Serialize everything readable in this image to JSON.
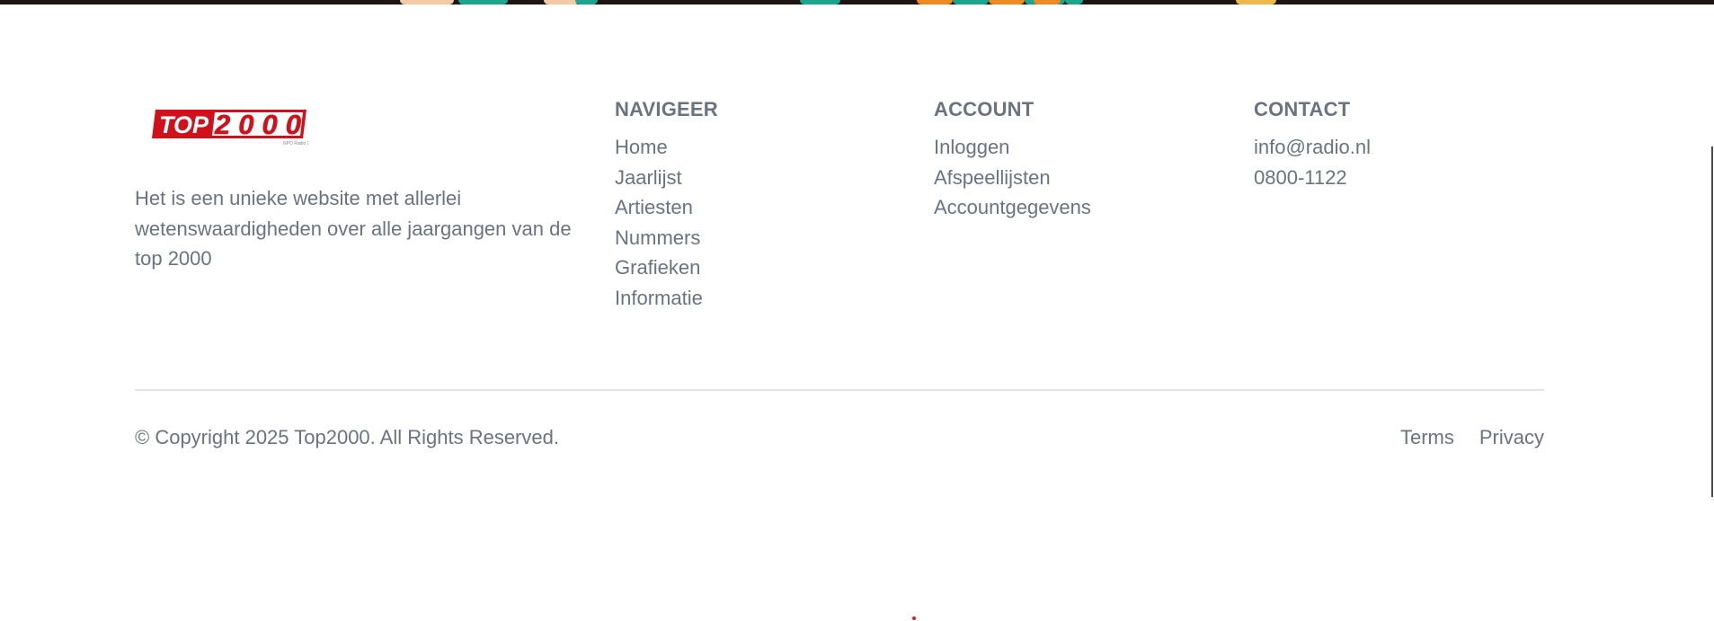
{
  "brand": {
    "logo_text": "TOP2000",
    "logo_small_text": "NPO Radio 2",
    "description": "Het is een unieke website met allerlei wetenswaardigheden over alle jaargangen van de top 2000"
  },
  "nav": {
    "heading": "NAVIGEER",
    "items": [
      {
        "label": "Home"
      },
      {
        "label": "Jaarlijst"
      },
      {
        "label": "Artiesten"
      },
      {
        "label": "Nummers"
      },
      {
        "label": "Grafieken"
      },
      {
        "label": "Informatie"
      }
    ]
  },
  "account": {
    "heading": "ACCOUNT",
    "items": [
      {
        "label": "Inloggen"
      },
      {
        "label": "Afspeellijsten"
      },
      {
        "label": "Accountgegevens"
      }
    ]
  },
  "contact": {
    "heading": "CONTACT",
    "email": "info@radio.nl",
    "phone": "0800-1122"
  },
  "bottom": {
    "copyright": "© Copyright 2025 Top2000. All Rights Reserved.",
    "terms": "Terms",
    "privacy": "Privacy"
  },
  "colors": {
    "text": "#6b7280",
    "logo_red": "#d0101a",
    "divider": "#e2e4e8",
    "top_strip": "#1f1414"
  }
}
